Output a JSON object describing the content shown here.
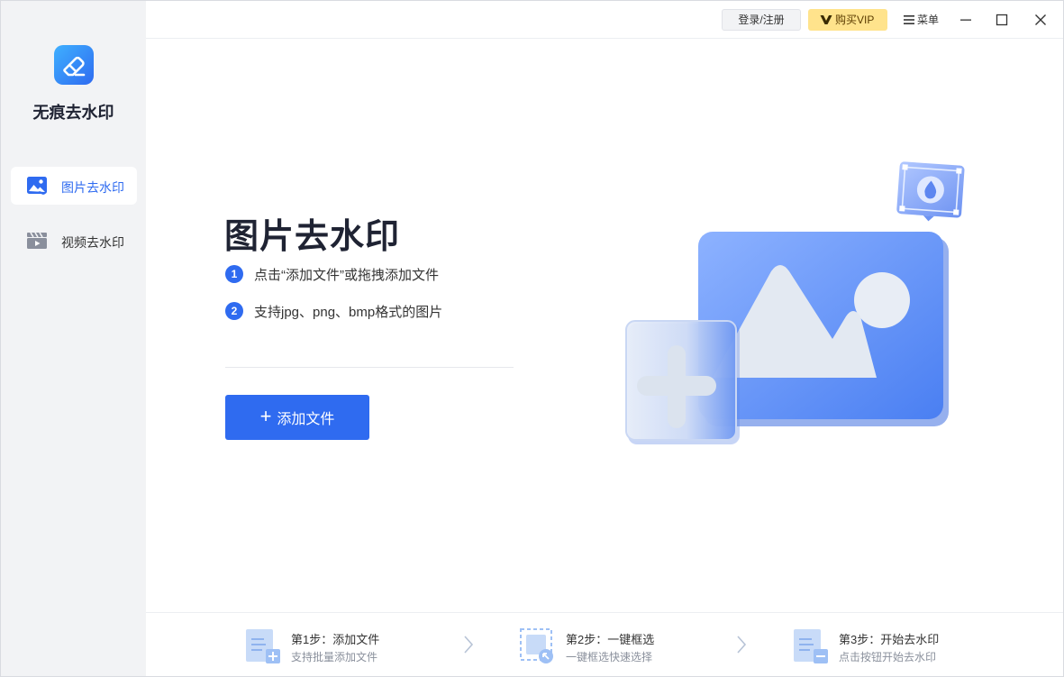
{
  "app": {
    "name": "无痕去水印"
  },
  "sidebar": {
    "items": [
      {
        "label": "图片去水印",
        "icon": "image-icon",
        "active": true
      },
      {
        "label": "视频去水印",
        "icon": "video-icon",
        "active": false
      }
    ]
  },
  "titlebar": {
    "login_label": "登录/注册",
    "vip_label": "购买VIP",
    "menu_label": "菜单",
    "minimize_icon": "minimize-icon",
    "maximize_icon": "maximize-icon",
    "close_icon": "close-icon"
  },
  "main": {
    "title": "图片去水印",
    "tips": [
      {
        "num": "1",
        "text": "点击“添加文件”或拖拽添加文件"
      },
      {
        "num": "2",
        "text": "支持jpg、png、bmp格式的图片"
      }
    ],
    "add_button_label": "添加文件"
  },
  "steps": [
    {
      "title": "第1步：添加文件",
      "desc": "支持批量添加文件",
      "icon": "add-file-icon"
    },
    {
      "title": "第2步：一键框选",
      "desc": "一键框选快速选择",
      "icon": "select-box-icon"
    },
    {
      "title": "第3步：开始去水印",
      "desc": "点击按钮开始去水印",
      "icon": "remove-file-icon"
    }
  ],
  "colors": {
    "accent": "#2f6bf0",
    "sidebar_bg": "#f2f3f5",
    "vip_bg": "#ffe38c"
  }
}
